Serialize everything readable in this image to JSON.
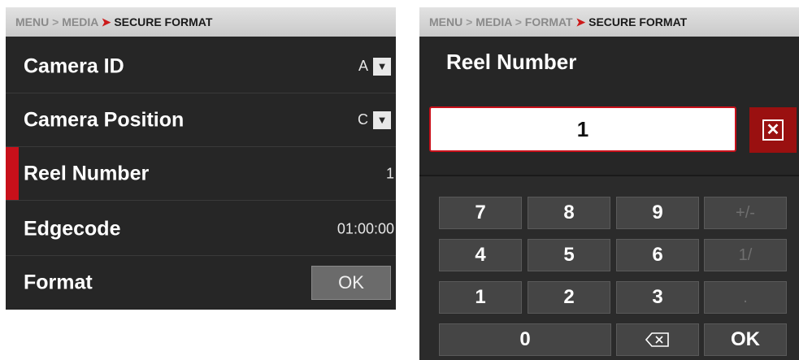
{
  "left": {
    "breadcrumb": {
      "menu": "MENU",
      "sep": ">",
      "media": "MEDIA",
      "current": "SECURE FORMAT"
    },
    "rows": [
      {
        "label": "Camera ID",
        "value": "A"
      },
      {
        "label": "Camera Position",
        "value": "C"
      },
      {
        "label": "Reel Number",
        "value": "1"
      },
      {
        "label": "Edgecode",
        "value": "01:00:00"
      },
      {
        "label": "Format",
        "button": "OK"
      }
    ]
  },
  "right": {
    "breadcrumb": {
      "menu": "MENU",
      "sep": ">",
      "media": "MEDIA",
      "format": "FORMAT",
      "current": "SECURE FORMAT"
    },
    "title": "Reel Number",
    "input_value": "1",
    "keys": {
      "row1": [
        "7",
        "8",
        "9",
        "+/-"
      ],
      "row2": [
        "4",
        "5",
        "6",
        "1/"
      ],
      "row3": [
        "1",
        "2",
        "3",
        "."
      ],
      "zero": "0",
      "ok": "OK"
    }
  },
  "colors": {
    "accent": "#c8101a",
    "bg": "#262626"
  }
}
